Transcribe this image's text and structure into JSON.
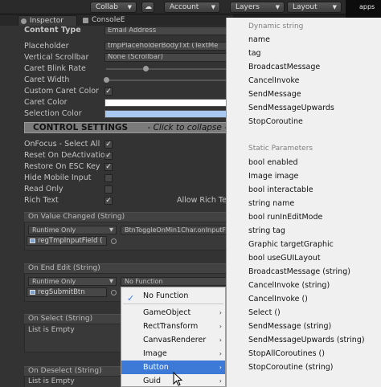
{
  "toolbar": {
    "collab": "Collab",
    "account": "Account",
    "layers": "Layers",
    "layout": "Layout",
    "right_text": "apps"
  },
  "tabs": [
    {
      "label": "Inspector",
      "icon": "info-icon"
    },
    {
      "label": "ConsoleE",
      "icon": "console-icon"
    }
  ],
  "inspector": {
    "content_type": {
      "label": "Content Type",
      "value": "Email Address"
    },
    "placeholder": {
      "label": "Placeholder",
      "value": "tmpPlaceholderBodyTxt (TextMe"
    },
    "vertical_scrollbar": {
      "label": "Vertical Scrollbar",
      "value": "None (Scrollbar)"
    },
    "caret_blink_rate": {
      "label": "Caret Blink Rate",
      "value": 0.85
    },
    "caret_width": {
      "label": "Caret Width",
      "value": 0.0
    },
    "custom_caret_color": {
      "label": "Custom Caret Color",
      "checked": true
    },
    "caret_color": {
      "label": "Caret Color",
      "color": "#ffffff"
    },
    "selection_color": {
      "label": "Selection Color",
      "color": "#a8c8f0"
    },
    "control_settings": {
      "title": "CONTROL SETTINGS",
      "hint": "- Click to collapse -"
    },
    "checkboxes": [
      {
        "label": "OnFocus - Select All",
        "checked": true
      },
      {
        "label": "Reset On DeActivation",
        "checked": true
      },
      {
        "label": "Restore On ESC Key",
        "checked": true
      },
      {
        "label": "Hide Mobile Input",
        "checked": false
      },
      {
        "label": "Read Only",
        "checked": false
      },
      {
        "label": "Rich Text",
        "checked": true
      }
    ],
    "allow_rich_text": "Allow Rich Te",
    "on_value_changed": {
      "header": "On Value Changed (String)",
      "mode": "Runtime Only",
      "function": "BtnToggleOnMin1Char.onInputF",
      "object": "regTmpInputField ("
    },
    "on_end_edit": {
      "header": "On End Edit (String)",
      "mode": "Runtime Only",
      "function": "No Function",
      "object": "regSubmitBtn"
    },
    "on_select": {
      "header": "On Select (String)",
      "empty": "List is Empty"
    },
    "on_deselect": {
      "header": "On Deselect (String)",
      "empty": "List is Empty"
    }
  },
  "right_menu": {
    "dynamic_header": "Dynamic string",
    "dynamic_items": [
      "name",
      "tag",
      "BroadcastMessage",
      "CancelInvoke",
      "SendMessage",
      "SendMessageUpwards",
      "StopCoroutine"
    ],
    "static_header": "Static Parameters",
    "static_items": [
      "bool enabled",
      "Image image",
      "bool interactable",
      "string name",
      "bool runInEditMode",
      "string tag",
      "Graphic targetGraphic",
      "bool useGUILayout",
      "BroadcastMessage (string)",
      "CancelInvoke (string)",
      "CancelInvoke ()",
      "Select ()",
      "SendMessage (string)",
      "SendMessageUpwards (string)",
      "StopAllCoroutines ()",
      "StopCoroutine (string)"
    ]
  },
  "function_menu": {
    "no_function": "No Function",
    "items": [
      "GameObject",
      "RectTransform",
      "CanvasRenderer",
      "Image",
      "Button",
      "Guid"
    ],
    "selected": "Button"
  },
  "colors": {
    "accent": "#3d7ad8",
    "panel": "#333333",
    "menu_bg": "#f0f0f0"
  }
}
